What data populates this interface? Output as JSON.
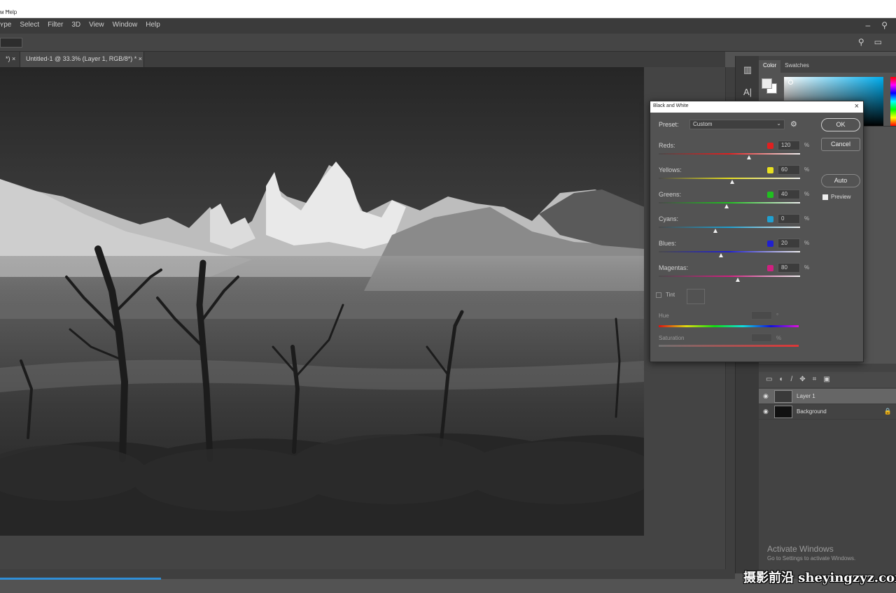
{
  "titlebar": {
    "title": "ᴍ Ħelp"
  },
  "menu": {
    "items": [
      "ʏpe",
      "Select",
      "Filter",
      "3D",
      "View",
      "Window",
      "Help"
    ]
  },
  "tabs": {
    "prev": "*) ×",
    "doc": "Untitled-1 @ 33.3% (Layer 1, RGB/8*) * ×"
  },
  "panels": {
    "tabs": [
      "Color",
      "Swatches"
    ],
    "fg_color": "#ebebeb",
    "bg_color": "#ffffff"
  },
  "dialog": {
    "title": "Black and White",
    "preset_label": "Preset:",
    "preset_value": "Custom",
    "ok": "OK",
    "cancel": "Cancel",
    "auto": "Auto",
    "preview": "Preview",
    "sliders": [
      {
        "label": "Reds:",
        "value": "120",
        "fraction": 0.64,
        "color": "#e02020"
      },
      {
        "label": "Yellows:",
        "value": "60",
        "fraction": 0.52,
        "color": "#e8e020"
      },
      {
        "label": "Greens:",
        "value": "40",
        "fraction": 0.48,
        "color": "#20c020"
      },
      {
        "label": "Cyans:",
        "value": "0",
        "fraction": 0.4,
        "color": "#20a0d0"
      },
      {
        "label": "Blues:",
        "value": "20",
        "fraction": 0.44,
        "color": "#2020d0"
      },
      {
        "label": "Magentas:",
        "value": "80",
        "fraction": 0.56,
        "color": "#d02080"
      }
    ],
    "tint_label": "Tint",
    "hue_label": "Hue",
    "saturation_label": "Saturation"
  },
  "layers": {
    "rows": [
      {
        "name": "Layer 1",
        "selected": true
      },
      {
        "name": "Background",
        "selected": false
      }
    ]
  },
  "activation": {
    "line1": "Activate Windows",
    "line2": "Go to Settings to activate Windows."
  },
  "site_watermark": "摄影前沿 sheyingzyz.com"
}
